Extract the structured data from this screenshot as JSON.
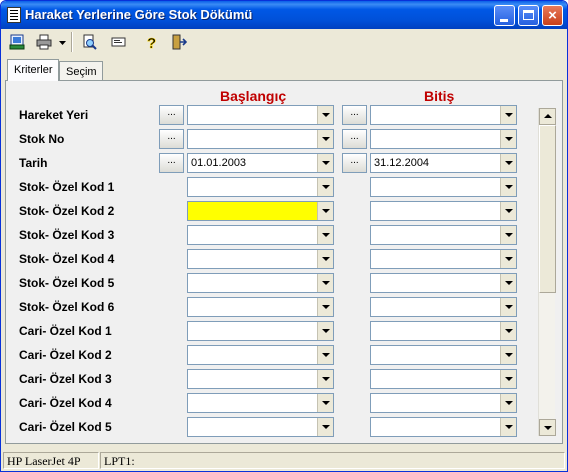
{
  "window": {
    "title": "Haraket Yerlerine Göre Stok Dökümü",
    "controls": {
      "minimize": "minimize",
      "maximize": "maximize",
      "close": "×"
    }
  },
  "toolbar": {
    "icons": [
      "export-icon",
      "print-icon",
      "preview-icon",
      "copy-icon",
      "help-icon",
      "exit-icon"
    ],
    "help_glyph": "?"
  },
  "tabs": [
    {
      "label": "Kriterler",
      "active": true
    },
    {
      "label": "Seçim",
      "active": false
    }
  ],
  "form": {
    "start_header": "Başlangıç",
    "end_header": "Bitiş",
    "lookup_button": "...",
    "rows": [
      {
        "label": "Hareket Yeri",
        "start": "",
        "end": "",
        "lookup": true
      },
      {
        "label": "Stok No",
        "start": "",
        "end": "",
        "lookup": true
      },
      {
        "label": "Tarih",
        "start": "01.01.2003",
        "end": "31.12.2004",
        "lookup": true
      },
      {
        "label": "Stok- Özel Kod 1",
        "start": "",
        "end": "",
        "lookup": false
      },
      {
        "label": "Stok- Özel Kod 2",
        "start": "",
        "end": "",
        "lookup": false,
        "highlight": true
      },
      {
        "label": "Stok- Özel Kod 3",
        "start": "",
        "end": "",
        "lookup": false
      },
      {
        "label": "Stok- Özel Kod 4",
        "start": "",
        "end": "",
        "lookup": false
      },
      {
        "label": "Stok- Özel Kod 5",
        "start": "",
        "end": "",
        "lookup": false
      },
      {
        "label": "Stok- Özel Kod 6",
        "start": "",
        "end": "",
        "lookup": false
      },
      {
        "label": "Cari- Özel Kod 1",
        "start": "",
        "end": "",
        "lookup": false
      },
      {
        "label": "Cari- Özel Kod 2",
        "start": "",
        "end": "",
        "lookup": false
      },
      {
        "label": "Cari- Özel Kod 3",
        "start": "",
        "end": "",
        "lookup": false
      },
      {
        "label": "Cari- Özel Kod 4",
        "start": "",
        "end": "",
        "lookup": false
      },
      {
        "label": "Cari- Özel Kod 5",
        "start": "",
        "end": "",
        "lookup": false
      }
    ]
  },
  "colors": {
    "header_red": "#c00000",
    "highlight_yellow": "#ffff00",
    "titlebar_blue": "#0058e6"
  },
  "statusbar": {
    "printer": "HP LaserJet 4P",
    "port": "LPT1:"
  }
}
